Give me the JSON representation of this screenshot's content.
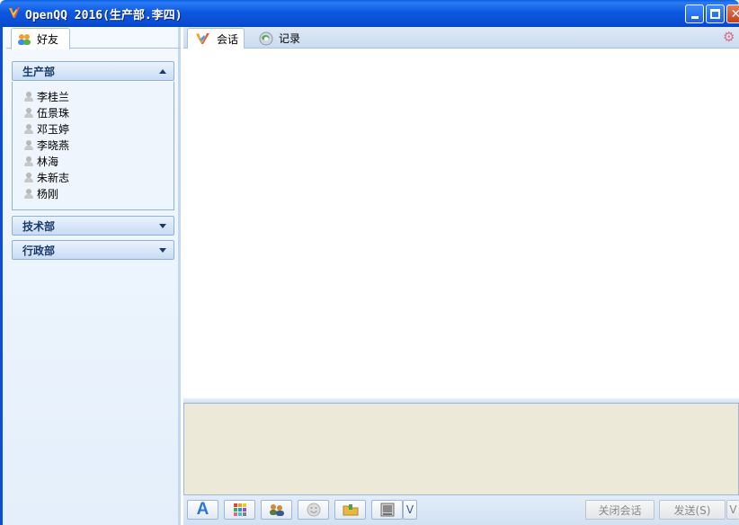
{
  "window": {
    "title": "OpenQQ 2016(生产部.李四)",
    "icon": "qq-logo-icon"
  },
  "left_panel": {
    "tab_label": "好友",
    "groups": [
      {
        "name": "生产部",
        "expanded": true,
        "members": [
          "李桂兰",
          "伍景珠",
          "邓玉婷",
          "李晓燕",
          "林海",
          "朱新志",
          "杨刚"
        ]
      },
      {
        "name": "技术部",
        "expanded": false
      },
      {
        "name": "行政部",
        "expanded": false
      }
    ]
  },
  "right_panel": {
    "tabs": [
      {
        "label": "会话",
        "icon": "chat-icon",
        "active": true
      },
      {
        "label": "记录",
        "icon": "history-icon",
        "active": false
      }
    ],
    "toolbar": {
      "font_label": "A",
      "more_glyph": "V"
    },
    "actions": {
      "close_label": "关闭会话",
      "send_label": "发送(S)",
      "send_more_glyph": "V"
    }
  },
  "colors": {
    "titlebar": "#0a4fd6",
    "panel_bg": "#e4effb",
    "input_bg": "#ece9d8",
    "accent": "#2a78d6"
  }
}
